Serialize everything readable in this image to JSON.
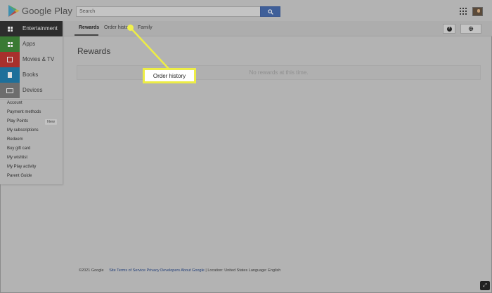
{
  "brand": {
    "name": "Google Play"
  },
  "search": {
    "placeholder": "Search"
  },
  "tabs": [
    {
      "label": "Rewards",
      "active": true
    },
    {
      "label": "Order history",
      "active": false
    },
    {
      "label": "Family",
      "active": false
    }
  ],
  "sidebar": {
    "categories": [
      {
        "label": "Entertainment",
        "color": "#2d2d2d",
        "icon": "entertainment-icon"
      },
      {
        "label": "Apps",
        "color": "#3a7a34",
        "icon": "apps-category-icon"
      },
      {
        "label": "Movies & TV",
        "color": "#a8302c",
        "icon": "movies-icon"
      },
      {
        "label": "Books",
        "color": "#1e6f9a",
        "icon": "books-icon"
      },
      {
        "label": "Devices",
        "color": "#6d6d6d",
        "icon": "devices-icon"
      }
    ],
    "links": [
      {
        "label": "Account"
      },
      {
        "label": "Payment methods"
      },
      {
        "label": "Play Points",
        "badge": "New"
      },
      {
        "label": "My subscriptions"
      },
      {
        "label": "Redeem"
      },
      {
        "label": "Buy gift card"
      },
      {
        "label": "My wishlist"
      },
      {
        "label": "My Play activity"
      },
      {
        "label": "Parent Guide"
      }
    ]
  },
  "main": {
    "title": "Rewards",
    "empty_message": "No rewards at this time."
  },
  "callout": {
    "label": "Order history",
    "color": "#eded45"
  },
  "footer": {
    "copyright": "©2021 Google",
    "links": [
      "Site Terms of Service",
      "Privacy",
      "Developers",
      "About Google"
    ],
    "separator": "|",
    "location": "Location: United States",
    "language": "Language: English"
  }
}
